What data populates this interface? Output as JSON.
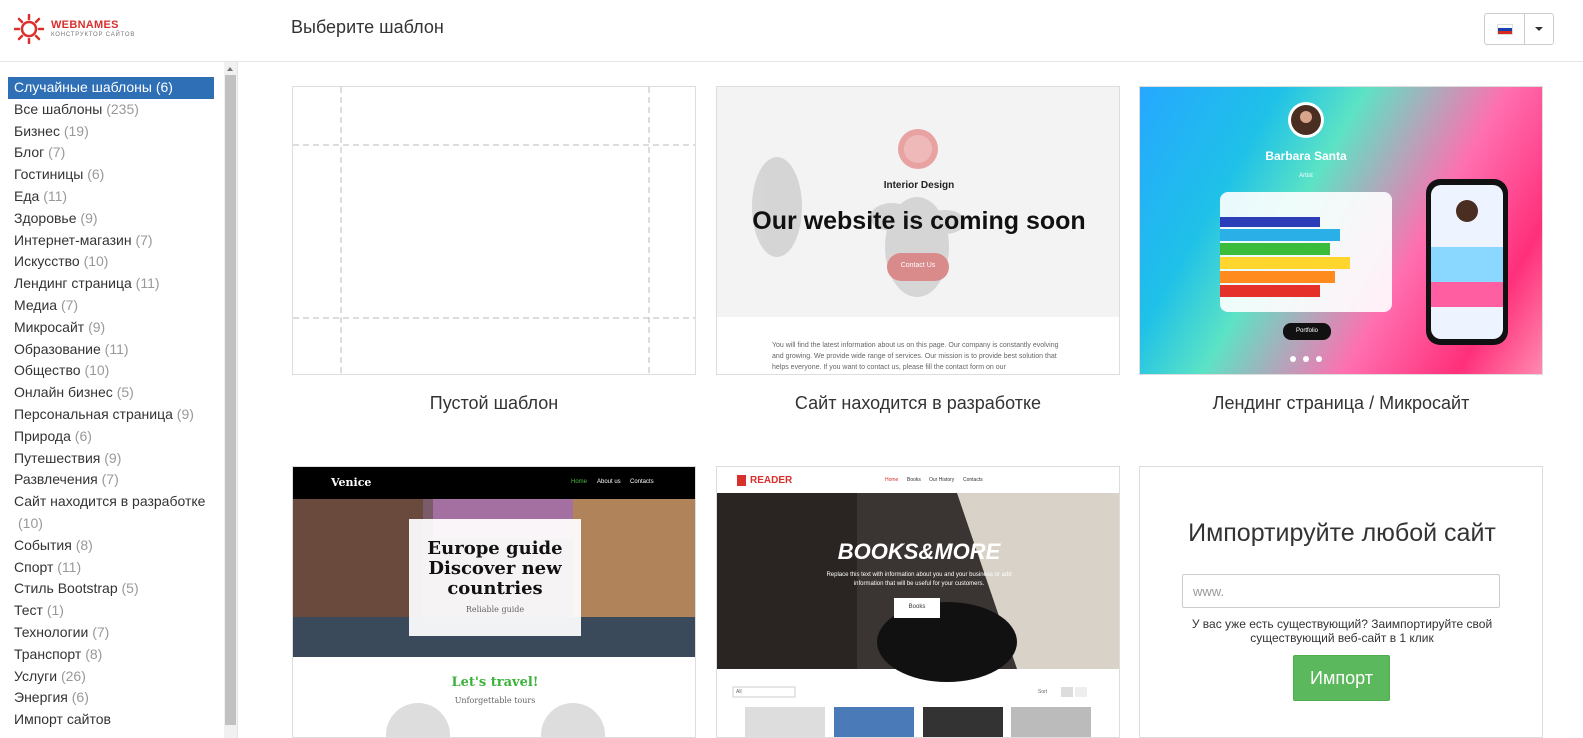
{
  "header": {
    "logo_name": "WEBNAMES",
    "logo_sub": "КОНСТРУКТОР САЙТОВ",
    "title": "Выберите шаблон",
    "lang_flag_icon": "russian-flag-icon"
  },
  "sidebar": {
    "categories": [
      {
        "label": "Случайные шаблоны",
        "count": "(6)",
        "active": true
      },
      {
        "label": "Все шаблоны",
        "count": "(235)"
      },
      {
        "label": "Бизнес",
        "count": "(19)"
      },
      {
        "label": "Блог",
        "count": "(7)"
      },
      {
        "label": "Гостиницы",
        "count": "(6)"
      },
      {
        "label": "Еда",
        "count": "(11)"
      },
      {
        "label": "Здоровье",
        "count": "(9)"
      },
      {
        "label": "Интернет-магазин",
        "count": "(7)"
      },
      {
        "label": "Искусство",
        "count": "(10)"
      },
      {
        "label": "Лендинг страница",
        "count": "(11)"
      },
      {
        "label": "Медиа",
        "count": "(7)"
      },
      {
        "label": "Микросайт",
        "count": "(9)"
      },
      {
        "label": "Образование",
        "count": "(11)"
      },
      {
        "label": "Общество",
        "count": "(10)"
      },
      {
        "label": "Онлайн бизнес",
        "count": "(5)"
      },
      {
        "label": "Персональная страница",
        "count": "(9)"
      },
      {
        "label": "Природа",
        "count": "(6)"
      },
      {
        "label": "Путешествия",
        "count": "(9)"
      },
      {
        "label": "Развлечения",
        "count": "(7)"
      },
      {
        "label": "Сайт находится в разработке",
        "count": "(10)",
        "wrap": true
      },
      {
        "label": "События",
        "count": "(8)"
      },
      {
        "label": "Спорт",
        "count": "(11)"
      },
      {
        "label": "Стиль Bootstrap",
        "count": "(5)"
      },
      {
        "label": "Тест",
        "count": "(1)"
      },
      {
        "label": "Технологии",
        "count": "(7)"
      },
      {
        "label": "Транспорт",
        "count": "(8)"
      },
      {
        "label": "Услуги",
        "count": "(26)"
      },
      {
        "label": "Энергия",
        "count": "(6)"
      },
      {
        "label": "Импорт сайтов",
        "count": ""
      }
    ]
  },
  "templates": {
    "t1": {
      "label": "Пустой шаблон"
    },
    "t2": {
      "label": "Сайт находится в разработке",
      "sub": "Interior Design",
      "heading": "Our website is coming soon",
      "button": "Contact Us",
      "body": "You will find the latest information about us on this page. Our company is constantly evolving and growing. We provide wide range of services. Our mission is to provide best solution that helps everyone. If you want to contact us, please fill the contact form on our"
    },
    "t3": {
      "label": "Лендинг страница / Микросайт",
      "name": "Barbara Santa",
      "role": "Artist",
      "button": "Portfolio"
    },
    "t4": {
      "brand": "Venice",
      "nav": [
        "Home",
        "About us",
        "Contacts"
      ],
      "headline": "Europe guide Discover new countries",
      "subline": "Reliable guide",
      "tagline": "Let's travel!",
      "tagline_sub": "Unforgettable tours"
    },
    "t5": {
      "brand": "READER",
      "nav": [
        "Home",
        "Books",
        "Our History",
        "Contacts"
      ],
      "headline": "BOOKS&MORE",
      "text": "Replace this text with information about you and your business or add information that will be useful for your customers.",
      "button": "Books",
      "filter": "All",
      "sort": "Sort"
    }
  },
  "import": {
    "title": "Импортируйте любой сайт",
    "placeholder": "www.",
    "hint": "У вас уже есть существующий? Заимпортируйте свой существующий веб-сайт в 1 клик",
    "button": "Импорт"
  },
  "colors": {
    "accent": "#2f6fb6",
    "import_button": "#5cb85c",
    "brand_red": "#d9302c"
  }
}
